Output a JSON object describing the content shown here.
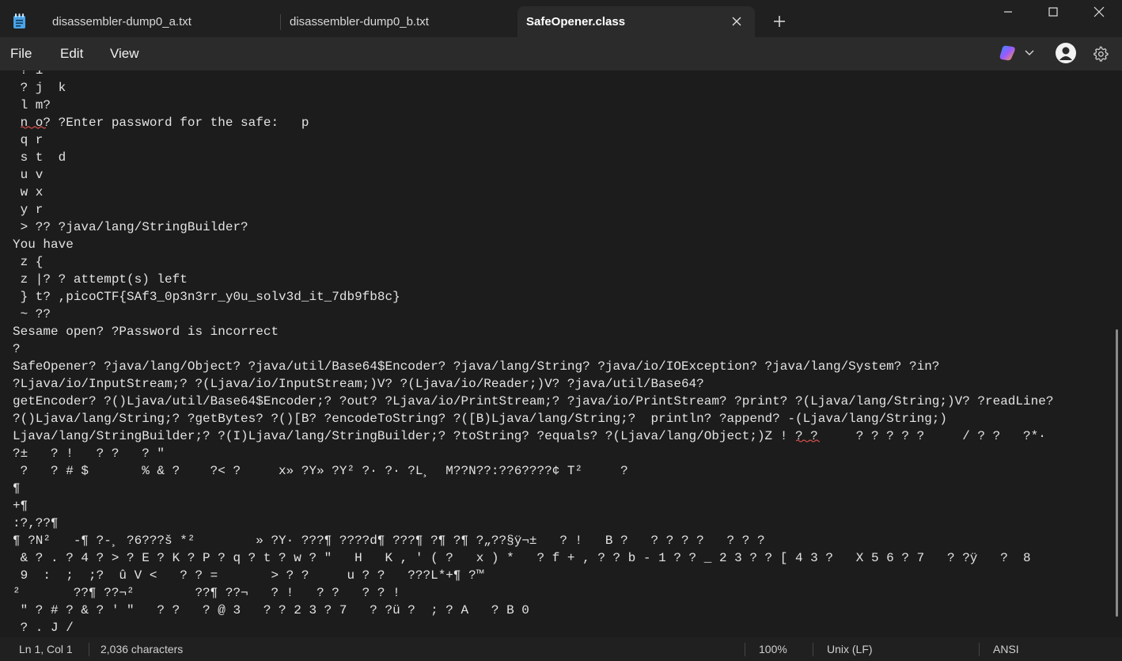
{
  "tabs": [
    {
      "label": "disassembler-dump0_a.txt",
      "active": false
    },
    {
      "label": "disassembler-dump0_b.txt",
      "active": false
    },
    {
      "label": "SafeOpener.class",
      "active": true
    }
  ],
  "menu": [
    "File",
    "Edit",
    "View"
  ],
  "editor": {
    "lines": [
      " ? i",
      " ? j  k",
      " l m?",
      " n o? ?Enter password for the safe:   p",
      " q r",
      " s t  d",
      " u v",
      " w x",
      " y r",
      " > ?? ?java/lang/StringBuilder?",
      "You have",
      " z {",
      " z |? ? attempt(s) left",
      " } t? ,picoCTF{SAf3_0p3n3rr_y0u_solv3d_it_7db9fb8c}",
      " ~ ??",
      "Sesame open? ?Password is incorrect",
      "?",
      "SafeOpener? ?java/lang/Object? ?java/util/Base64$Encoder? ?java/lang/String? ?java/io/IOException? ?java/lang/System? ?in?",
      "?Ljava/io/InputStream;? ?(Ljava/io/InputStream;)V? ?(Ljava/io/Reader;)V? ?java/util/Base64?",
      "getEncoder? ?()Ljava/util/Base64$Encoder;? ?out? ?Ljava/io/PrintStream;? ?java/io/PrintStream? ?print? ?(Ljava/lang/String;)V? ?readLine?",
      "?()Ljava/lang/String;? ?getBytes? ?()[B? ?encodeToString? ?([B)Ljava/lang/String;?  println? ?append? -(Ljava/lang/String;)",
      "Ljava/lang/StringBuilder;? ?(I)Ljava/lang/StringBuilder;? ?toString? ?equals? ?(Ljava/lang/Object;)Z ! ? ?     ? ? ? ? ?     / ? ?   ?*·",
      "?±   ? !   ? ?   ? \"",
      " ?   ? # $       % & ?    ?< ?     x» ?Y» ?Y² ?· ?· ?L¸  M??N??:??6????¢ T²     ?",
      "¶",
      "+¶",
      ":?,??¶",
      "¶ ?N²   -¶ ?-¸ ?6???š *²        » ?Y· ???¶ ????d¶ ???¶ ?¶ ?¶ ?„??§ÿ¬±   ? !   B ?   ? ? ? ?   ? ? ?",
      " & ? . ? 4 ? > ? E ? K ? P ? q ? t ? w ? \"   H   K , ' ( ?   x ) *   ? f + , ? ? b - 1 ? ? _ 2 3 ? ? [ 4 3 ?   X 5 6 ? 7   ? ?ÿ   ?  8",
      " 9  :  ;  ;?  û V <   ? ? =       > ? ?     u ? ?   ???L*+¶ ?™",
      "²       ??¶ ??¬²        ??¶ ??¬   ? !   ? ?   ? ? !",
      " \" ? # ? & ? ' \"   ? ?   ? @ 3   ? ? 2 3 ? 7   ? ?ü ?  ; ? A   ? B 0",
      " ? . J /"
    ]
  },
  "status": {
    "position": "Ln 1, Col 1",
    "characters": "2,036 characters",
    "zoom": "100%",
    "line_ending": "Unix (LF)",
    "encoding": "ANSI"
  },
  "colors": {
    "background": "#1c1c1c",
    "chrome": "#2b2b2b",
    "tabbar": "#202020",
    "text": "#e3e3e3",
    "spell_underline": "#d9534f"
  }
}
